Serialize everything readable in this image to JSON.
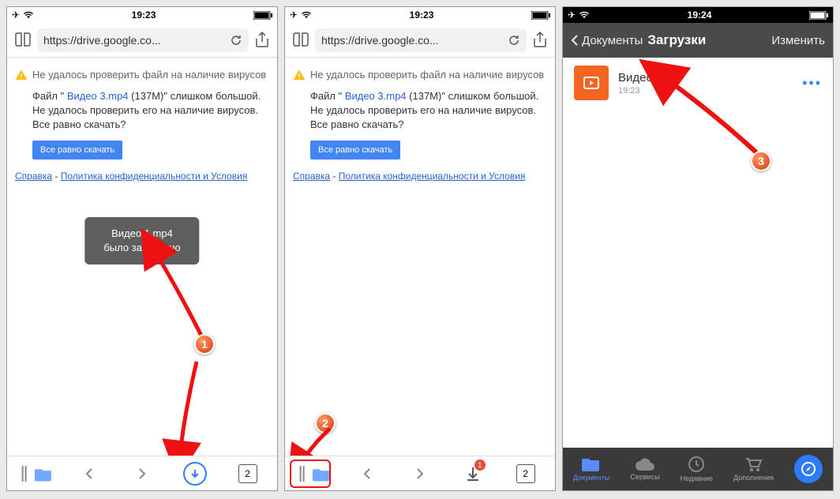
{
  "screen1": {
    "time": "19:23",
    "url": "https://drive.google.co...",
    "warn_title": "Не удалось проверить файл на наличие вирусов",
    "warn_prefix": "Файл \" ",
    "warn_link": "Видео 3.mp4",
    "warn_suffix": " (137М)\" слишком большой. Не удалось проверить его на наличие вирусов. Все равно скачать?",
    "download_btn": "Все равно скачать",
    "help": "Справка",
    "dash": " - ",
    "policy": "Политика конфиденциальности и Условия",
    "toast1": "Видео 1.mp4",
    "toast2": "было загружено",
    "tabs_count": "2",
    "badge1": "1"
  },
  "screen2": {
    "time": "19:23",
    "url": "https://drive.google.co...",
    "tabs_count": "2",
    "dl_badge": "1",
    "badge2": "2"
  },
  "screen3": {
    "time": "19:24",
    "back": "Документы",
    "title": "Загрузки",
    "edit": "Изменить",
    "file_name": "Видео 1",
    "file_time": "19:23",
    "more": "•••",
    "tab_docs": "Документы",
    "tab_services": "Сервисы",
    "tab_recent": "Недавние",
    "tab_addons": "Дополнения",
    "badge3": "3"
  }
}
